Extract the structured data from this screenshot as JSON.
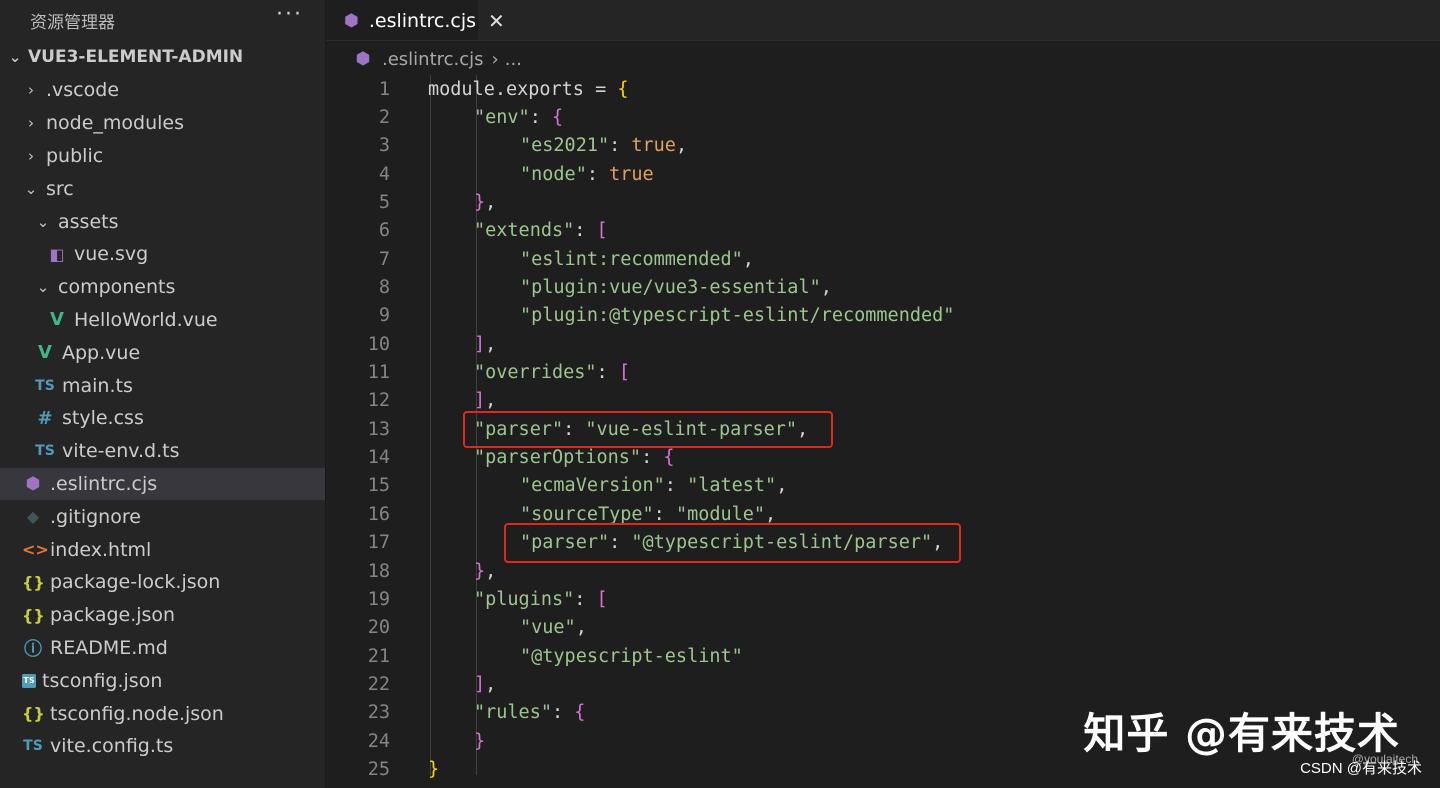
{
  "sidebar": {
    "title": "资源管理器",
    "more": "···",
    "project": "VUE3-ELEMENT-ADMIN",
    "items": [
      {
        "label": ".vscode",
        "indent": 0,
        "chevron": "›",
        "icon": ""
      },
      {
        "label": "node_modules",
        "indent": 0,
        "chevron": "›",
        "icon": ""
      },
      {
        "label": "public",
        "indent": 0,
        "chevron": "›",
        "icon": ""
      },
      {
        "label": "src",
        "indent": 0,
        "chevron": "⌄",
        "icon": ""
      },
      {
        "label": "assets",
        "indent": 1,
        "chevron": "⌄",
        "icon": ""
      },
      {
        "label": "vue.svg",
        "indent": 2,
        "chevron": "",
        "icon": "svg"
      },
      {
        "label": "components",
        "indent": 1,
        "chevron": "⌄",
        "icon": ""
      },
      {
        "label": "HelloWorld.vue",
        "indent": 2,
        "chevron": "",
        "icon": "vue"
      },
      {
        "label": "App.vue",
        "indent": 1,
        "chevron": "",
        "icon": "vue"
      },
      {
        "label": "main.ts",
        "indent": 1,
        "chevron": "",
        "icon": "ts"
      },
      {
        "label": "style.css",
        "indent": 1,
        "chevron": "",
        "icon": "css"
      },
      {
        "label": "vite-env.d.ts",
        "indent": 1,
        "chevron": "",
        "icon": "ts"
      },
      {
        "label": ".eslintrc.cjs",
        "indent": 0,
        "chevron": "",
        "icon": "eslint",
        "active": true
      },
      {
        "label": ".gitignore",
        "indent": 0,
        "chevron": "",
        "icon": "git"
      },
      {
        "label": "index.html",
        "indent": 0,
        "chevron": "",
        "icon": "html"
      },
      {
        "label": "package-lock.json",
        "indent": 0,
        "chevron": "",
        "icon": "json"
      },
      {
        "label": "package.json",
        "indent": 0,
        "chevron": "",
        "icon": "json"
      },
      {
        "label": "README.md",
        "indent": 0,
        "chevron": "",
        "icon": "info"
      },
      {
        "label": "tsconfig.json",
        "indent": 0,
        "chevron": "",
        "icon": "tsconfig"
      },
      {
        "label": "tsconfig.node.json",
        "indent": 0,
        "chevron": "",
        "icon": "json"
      },
      {
        "label": "vite.config.ts",
        "indent": 0,
        "chevron": "",
        "icon": "ts"
      }
    ]
  },
  "icons": {
    "ts": "TS",
    "css": "#",
    "json": "{}",
    "html": "<>",
    "git": "◆",
    "info": "ⓘ",
    "eslint": "⬢",
    "svg": "◧",
    "vue": "V",
    "tsconfig": "TS"
  },
  "editor": {
    "tab_label": ".eslintrc.cjs",
    "tab_close": "✕",
    "breadcrumb_file": ".eslintrc.cjs",
    "breadcrumb_sep": "›",
    "breadcrumb_more": "...",
    "lines": [
      {
        "n": "1",
        "indent": 0,
        "tokens": [
          [
            "txt",
            "module.exports = "
          ],
          [
            "b1",
            "{"
          ]
        ]
      },
      {
        "n": "2",
        "indent": 1,
        "tokens": [
          [
            "key",
            "\"env\""
          ],
          [
            "punc",
            ": "
          ],
          [
            "b2",
            "{"
          ]
        ]
      },
      {
        "n": "3",
        "indent": 2,
        "tokens": [
          [
            "key",
            "\"es2021\""
          ],
          [
            "punc",
            ": "
          ],
          [
            "bool",
            "true"
          ],
          [
            "punc",
            ","
          ]
        ]
      },
      {
        "n": "4",
        "indent": 2,
        "tokens": [
          [
            "key",
            "\"node\""
          ],
          [
            "punc",
            ": "
          ],
          [
            "bool",
            "true"
          ]
        ]
      },
      {
        "n": "5",
        "indent": 1,
        "tokens": [
          [
            "b2",
            "}"
          ],
          [
            "punc",
            ","
          ]
        ]
      },
      {
        "n": "6",
        "indent": 1,
        "tokens": [
          [
            "key",
            "\"extends\""
          ],
          [
            "punc",
            ": "
          ],
          [
            "b2",
            "["
          ]
        ]
      },
      {
        "n": "7",
        "indent": 2,
        "tokens": [
          [
            "str",
            "\"eslint:recommended\""
          ],
          [
            "punc",
            ","
          ]
        ]
      },
      {
        "n": "8",
        "indent": 2,
        "tokens": [
          [
            "str",
            "\"plugin:vue/vue3-essential\""
          ],
          [
            "punc",
            ","
          ]
        ]
      },
      {
        "n": "9",
        "indent": 2,
        "tokens": [
          [
            "str",
            "\"plugin:@typescript-eslint/recommended\""
          ]
        ]
      },
      {
        "n": "10",
        "indent": 1,
        "tokens": [
          [
            "b2",
            "]"
          ],
          [
            "punc",
            ","
          ]
        ]
      },
      {
        "n": "11",
        "indent": 1,
        "tokens": [
          [
            "key",
            "\"overrides\""
          ],
          [
            "punc",
            ": "
          ],
          [
            "b2",
            "["
          ]
        ]
      },
      {
        "n": "12",
        "indent": 1,
        "tokens": [
          [
            "b2",
            "]"
          ],
          [
            "punc",
            ","
          ]
        ]
      },
      {
        "n": "13",
        "indent": 1,
        "tokens": [
          [
            "key",
            "\"parser\""
          ],
          [
            "punc",
            ": "
          ],
          [
            "str",
            "\"vue-eslint-parser\""
          ],
          [
            "punc",
            ","
          ]
        ]
      },
      {
        "n": "14",
        "indent": 1,
        "tokens": [
          [
            "key",
            "\"parserOptions\""
          ],
          [
            "punc",
            ": "
          ],
          [
            "b2",
            "{"
          ]
        ]
      },
      {
        "n": "15",
        "indent": 2,
        "tokens": [
          [
            "key",
            "\"ecmaVersion\""
          ],
          [
            "punc",
            ": "
          ],
          [
            "str",
            "\"latest\""
          ],
          [
            "punc",
            ","
          ]
        ]
      },
      {
        "n": "16",
        "indent": 2,
        "tokens": [
          [
            "key",
            "\"sourceType\""
          ],
          [
            "punc",
            ": "
          ],
          [
            "str",
            "\"module\""
          ],
          [
            "punc",
            ","
          ]
        ]
      },
      {
        "n": "17",
        "indent": 2,
        "tokens": [
          [
            "key",
            "\"parser\""
          ],
          [
            "punc",
            ": "
          ],
          [
            "str",
            "\"@typescript-eslint/parser\""
          ],
          [
            "punc",
            ","
          ]
        ]
      },
      {
        "n": "18",
        "indent": 1,
        "tokens": [
          [
            "b2",
            "}"
          ],
          [
            "punc",
            ","
          ]
        ]
      },
      {
        "n": "19",
        "indent": 1,
        "tokens": [
          [
            "key",
            "\"plugins\""
          ],
          [
            "punc",
            ": "
          ],
          [
            "b2",
            "["
          ]
        ]
      },
      {
        "n": "20",
        "indent": 2,
        "tokens": [
          [
            "str",
            "\"vue\""
          ],
          [
            "punc",
            ","
          ]
        ]
      },
      {
        "n": "21",
        "indent": 2,
        "tokens": [
          [
            "str",
            "\"@typescript-eslint\""
          ]
        ]
      },
      {
        "n": "22",
        "indent": 1,
        "tokens": [
          [
            "b2",
            "]"
          ],
          [
            "punc",
            ","
          ]
        ]
      },
      {
        "n": "23",
        "indent": 1,
        "tokens": [
          [
            "key",
            "\"rules\""
          ],
          [
            "punc",
            ": "
          ],
          [
            "b2",
            "{"
          ]
        ]
      },
      {
        "n": "24",
        "indent": 1,
        "tokens": [
          [
            "b2",
            "}"
          ]
        ]
      },
      {
        "n": "25",
        "indent": 0,
        "tokens": [
          [
            "b1",
            "}"
          ]
        ]
      }
    ]
  },
  "watermark": {
    "main": "知乎 @有来技术",
    "csdn": "CSDN @有来技术",
    "faint": "@youlaitech"
  }
}
